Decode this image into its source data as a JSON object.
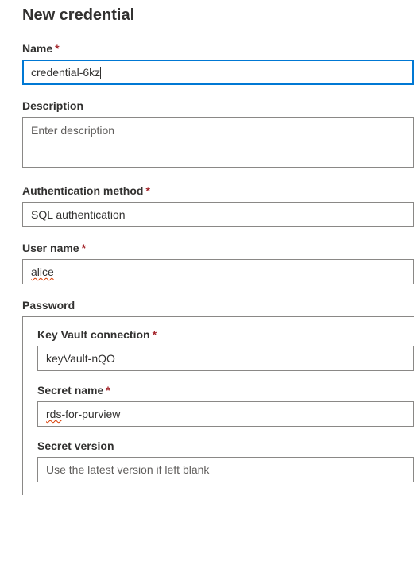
{
  "panel": {
    "title": "New credential"
  },
  "fields": {
    "name": {
      "label": "Name",
      "required_mark": "*",
      "value": "credential-6kz"
    },
    "description": {
      "label": "Description",
      "placeholder": "Enter description",
      "value": ""
    },
    "auth_method": {
      "label": "Authentication method",
      "required_mark": "*",
      "selected": "SQL authentication"
    },
    "username": {
      "label": "User name",
      "required_mark": "*",
      "value": "alice"
    },
    "password_group": {
      "label": "Password",
      "key_vault": {
        "label": "Key Vault connection",
        "required_mark": "*",
        "selected": "keyVault-nQO"
      },
      "secret_name": {
        "label": "Secret name",
        "required_mark": "*",
        "value_prefix": "rds",
        "value_suffix": "-for-purview"
      },
      "secret_version": {
        "label": "Secret version",
        "placeholder": "Use the latest version if left blank",
        "value": ""
      }
    }
  }
}
